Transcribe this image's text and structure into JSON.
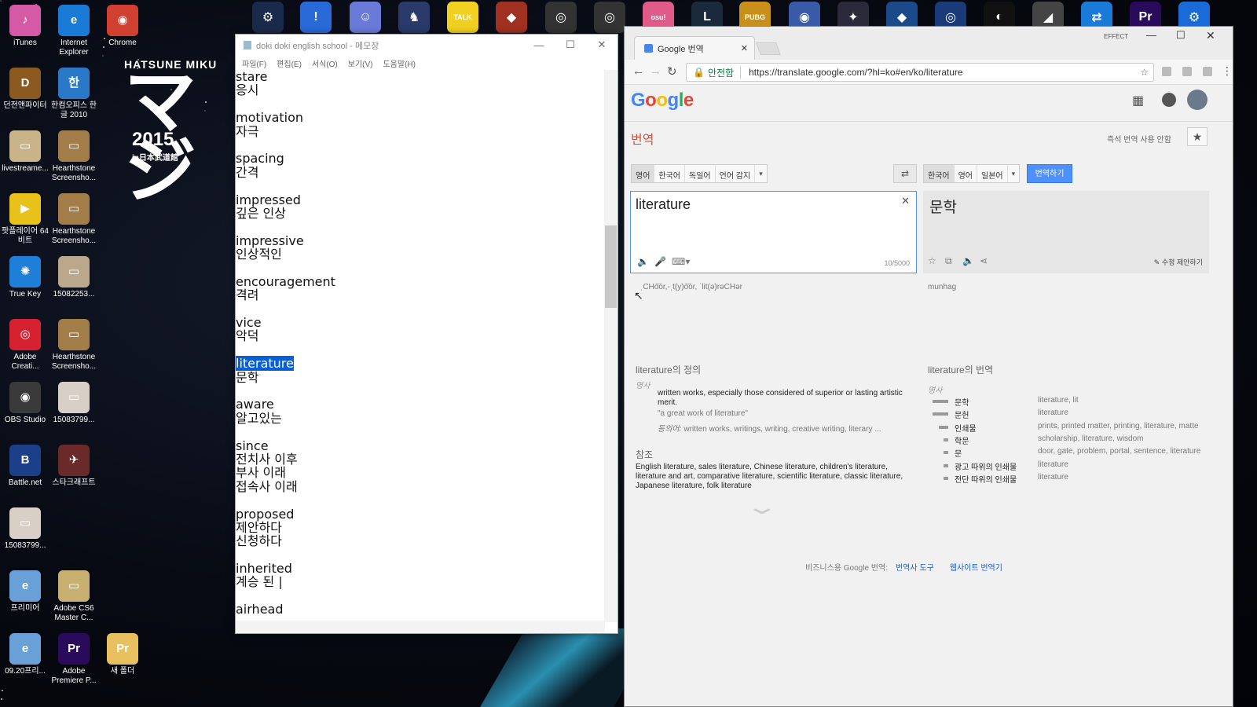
{
  "desktop": {
    "icons": [
      {
        "label": "iTunes",
        "icon": "itunes-icon",
        "color": "#d45aa6",
        "glyph": "♪"
      },
      {
        "label": "Internet Explorer",
        "icon": "internet-explorer-icon",
        "color": "#1a7bd6",
        "glyph": "e"
      },
      {
        "label": "Chrome",
        "icon": "chrome-icon",
        "color": "#d04030",
        "glyph": "◉"
      },
      {
        "label": "던전앤파이터",
        "icon": "game-dnf-icon",
        "color": "#8a5a20",
        "glyph": "D"
      },
      {
        "label": "한컴오피스 한글 2010",
        "icon": "hancom-icon",
        "color": "#2a78c8",
        "glyph": "한"
      },
      {
        "label": "livestreame...",
        "icon": "file-icon",
        "color": "#c9b48a",
        "glyph": "▭"
      },
      {
        "label": "Hearthstone Screensho...",
        "icon": "image-file-icon",
        "color": "#a27d4a",
        "glyph": "▭"
      },
      {
        "label": "팟플레이어 64 비트",
        "icon": "potplayer-icon",
        "color": "#e8c21a",
        "glyph": "▶"
      },
      {
        "label": "Hearthstone Screensho...",
        "icon": "image-file-icon",
        "color": "#a27d4a",
        "glyph": "▭"
      },
      {
        "label": "True Key",
        "icon": "truekey-icon",
        "color": "#1e7ed8",
        "glyph": "✺"
      },
      {
        "label": "15082253...",
        "icon": "image-file-icon",
        "color": "#bba88c",
        "glyph": "▭"
      },
      {
        "label": "Adobe Creati...",
        "icon": "adobe-cc-icon",
        "color": "#d62230",
        "glyph": "◎"
      },
      {
        "label": "Hearthstone Screensho...",
        "icon": "image-file-icon",
        "color": "#a27d4a",
        "glyph": "▭"
      },
      {
        "label": "OBS Studio",
        "icon": "obs-icon",
        "color": "#3a3a3a",
        "glyph": "◉"
      },
      {
        "label": "15083799...",
        "icon": "image-file-icon",
        "color": "#d8d0c6",
        "glyph": "▭"
      },
      {
        "label": "Battle.net",
        "icon": "battlenet-icon",
        "color": "#1c3f8a",
        "glyph": "B"
      },
      {
        "label": "스타크래프트",
        "icon": "starcraft-icon",
        "color": "#6a2a2a",
        "glyph": "✈"
      },
      {
        "label": "15083799...",
        "icon": "image-file-icon",
        "color": "#d8d0c6",
        "glyph": "▭"
      },
      {
        "label": "프리미어",
        "icon": "document-icon",
        "color": "#6aa0d8",
        "glyph": "e"
      },
      {
        "label": "Adobe CS6 Master C...",
        "icon": "folder-icon",
        "color": "#c8b070",
        "glyph": "▭"
      },
      {
        "label": "09.20프리...",
        "icon": "document-icon",
        "color": "#6aa0d8",
        "glyph": "e"
      },
      {
        "label": "Adobe Premiere P...",
        "icon": "premiere-icon",
        "color": "#2a0a5a",
        "glyph": "Pr"
      },
      {
        "label": "새 폴더",
        "icon": "folder-icon",
        "color": "#e8c060",
        "glyph": "Pr"
      }
    ],
    "taskbar_icons": [
      {
        "name": "steam-icon",
        "color": "#1a2a4a",
        "glyph": "⚙"
      },
      {
        "name": "app-icon",
        "color": "#2a6ad8",
        "glyph": "!"
      },
      {
        "name": "discord-icon",
        "color": "#6a7ad8",
        "glyph": "☺"
      },
      {
        "name": "game-icon",
        "color": "#2a3a6a",
        "glyph": "♞"
      },
      {
        "name": "kakaotalk-icon",
        "color": "#f0d020",
        "glyph": "TALK"
      },
      {
        "name": "game-icon",
        "color": "#a03020",
        "glyph": "◆"
      },
      {
        "name": "overwatch-icon",
        "color": "#333",
        "glyph": "◎"
      },
      {
        "name": "overwatch-icon",
        "color": "#333",
        "glyph": "◎"
      },
      {
        "name": "osu-icon",
        "color": "#e05a8a",
        "glyph": "osu!"
      },
      {
        "name": "league-icon",
        "color": "#1a2a3a",
        "glyph": "L"
      },
      {
        "name": "pubg-icon",
        "color": "#c8901a",
        "glyph": "PUBG"
      },
      {
        "name": "hearthstone-icon",
        "color": "#3a5aa8",
        "glyph": "◉"
      },
      {
        "name": "starcraft-icon",
        "color": "#2a2a3a",
        "glyph": "✦"
      },
      {
        "name": "app-icon",
        "color": "#1a4a8a",
        "glyph": "◆"
      },
      {
        "name": "app-icon",
        "color": "#1a3a7a",
        "glyph": "◎"
      },
      {
        "name": "app-icon",
        "color": "#111",
        "glyph": "◐"
      },
      {
        "name": "app-icon",
        "color": "#444",
        "glyph": "◢"
      },
      {
        "name": "teamviewer-icon",
        "color": "#1a7ad8",
        "glyph": "⇄"
      },
      {
        "name": "premiere-icon",
        "color": "#2a0a5a",
        "glyph": "Pr"
      },
      {
        "name": "settings-icon",
        "color": "#1a6ad8",
        "glyph": "⚙"
      }
    ],
    "wallpaper": {
      "title": "HATSUNE MIKU",
      "big": "マジ",
      "year": "2015",
      "sub": "in日本武道館"
    }
  },
  "notepad": {
    "title": "doki doki english school - 메모장",
    "menu": [
      "파일(F)",
      "편집(E)",
      "서식(O)",
      "보기(V)",
      "도움말(H)"
    ],
    "lines": [
      "stare",
      "응시",
      "",
      "motivation",
      "자극",
      "",
      "spacing",
      "간격",
      "",
      "impressed",
      "깊은 인상",
      "",
      "impressive",
      "인상적인",
      "",
      "encouragement",
      "격려",
      "",
      "vice",
      "악덕",
      "",
      "literature",
      "문학",
      "",
      "aware",
      "알고있는",
      "",
      "since",
      "전치사 이후",
      "부사 이래",
      "접속사 이래",
      "",
      "proposed",
      "제안하다",
      "신청하다",
      "",
      "inherited",
      "계승 된 |",
      "",
      "airhead"
    ],
    "selected_line": "literature"
  },
  "chrome": {
    "effect_label": "EFFECT",
    "tab_title": "Google 번역",
    "secure_label": "안전함",
    "url": "https://translate.google.com/?hl=ko#en/ko/literature",
    "logo": "Google",
    "heading": "번역",
    "instant_off": "즉석 번역 사용 안함",
    "src_langs": [
      "영어",
      "한국어",
      "독일어",
      "언어 감지"
    ],
    "tgt_langs": [
      "한국어",
      "영어",
      "일본어"
    ],
    "translate_btn": "번역하기",
    "input": "literature",
    "char_count": "10/5000",
    "output": "문학",
    "suggest_edit": "수정 제안하기",
    "src_phonetic": "ˌCHo͝or,-ˌt(y)o͝or, ˈlit(ə)rəCHər",
    "tgt_roman": "munhag",
    "def_title": "literature의 정의",
    "def_pos": "명사",
    "def_text": "written works, especially those considered of superior or lasting artistic merit.",
    "def_example": "\"a great work of literature\"",
    "def_syn_label": "동의어:",
    "def_syn": "written works, writings, writing, creative writing, literary ...",
    "ref_title": "참조",
    "ref_text": "English literature, sales literature, Chinese literature, children's literature, literature and art, comparative literature, scientific literature, classic literature, Japanese literature, folk literature",
    "trans_title": "literature의 번역",
    "trans_pos": "명사",
    "trans_rows": [
      {
        "ko": "문학",
        "en": "literature, lit",
        "freq": 3
      },
      {
        "ko": "문헌",
        "en": "literature",
        "freq": 3
      },
      {
        "ko": "인쇄물",
        "en": "prints, printed matter, printing, literature, matte",
        "freq": 2
      },
      {
        "ko": "학문",
        "en": "scholarship, literature, wisdom",
        "freq": 1
      },
      {
        "ko": "문",
        "en": "door, gate, problem, portal, sentence, literature",
        "freq": 1
      },
      {
        "ko": "광고 따위의 인쇄물",
        "en": "literature",
        "freq": 1
      },
      {
        "ko": "전단 따위의 인쇄물",
        "en": "literature",
        "freq": 1
      }
    ],
    "footer_text": "비즈니스용 Google 번역:",
    "footer_links": [
      "번역사 도구",
      "웹사이트 번역기"
    ]
  }
}
